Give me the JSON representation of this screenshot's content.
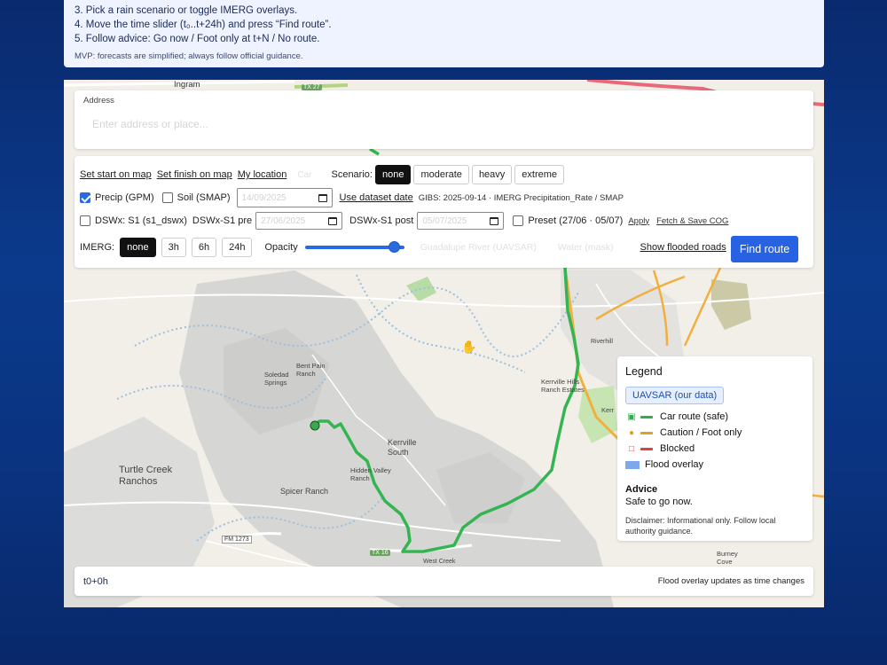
{
  "instructions": {
    "steps": [
      "3. Pick a rain scenario or toggle IMERG overlays.",
      "4. Move the time slider (t₀..t+24h) and press “Find route”.",
      "5. Follow advice: Go now / Foot only at t+N / No route."
    ],
    "disclaimer": "MVP: forecasts are simplified; always follow official guidance."
  },
  "map_labels": {
    "ingram": "Ingram",
    "tx27": "TX 27",
    "bent_pain": "Bent Pain Ranch",
    "soledad": "Soledad Springs",
    "kerrville_south": "Kerrville South",
    "hidden_valley": "Hidden Valley Ranch",
    "spicer": "Spicer Ranch",
    "turtle_creek": "Turtle Creek Ranchos",
    "fm1273": "FM 1273",
    "tx16": "TX 16",
    "west_creek": "West Creek",
    "kerrville_hills": "Kerrville Hills Ranch Estates",
    "riverhill": "Riverhill",
    "burney": "Burney Cove",
    "kerr": "Kerr"
  },
  "address": {
    "label": "Address",
    "placeholder": "Enter address or place..."
  },
  "controls": {
    "set_start": "Set start on map",
    "set_finish": "Set finish on map",
    "my_location": "My location",
    "car": "Car",
    "scenario_label": "Scenario:",
    "scenarios": [
      "none",
      "moderate",
      "heavy",
      "extreme"
    ],
    "scenario_active": "none",
    "precip_label": "Precip (GPM)",
    "soil_label": "Soil (SMAP)",
    "date_placeholder": "14/09/2025",
    "use_dataset_date": "Use dataset date",
    "gibs_info": "GIBS: 2025-09-14 · IMERG Precipitation_Rate / SMAP",
    "dswx_label": "DSWx: S1 (s1_dswx)",
    "dswx_pre_label": "DSWx-S1 pre",
    "dswx_pre_placeholder": "27/06/2025",
    "dswx_post_label": "DSWx-S1 post",
    "dswx_post_placeholder": "05/07/2025",
    "preset_label": "Preset (27/06 · 05/07)",
    "apply": "Apply",
    "fetch_save": "Fetch & Save COG",
    "imerg_label": "IMERG:",
    "imerg_options": [
      "none",
      "3h",
      "6h",
      "24h"
    ],
    "imerg_active": "none",
    "opacity_label": "Opacity",
    "opacity_value": 0.9,
    "guadalupe": "Guadalupe River (UAVSAR)",
    "water_mask": "Water (mask)",
    "show_flooded": "Show flooded roads",
    "find_route": "Find route"
  },
  "legend": {
    "title": "Legend",
    "badge": "UAVSAR (our data)",
    "items": [
      {
        "icon": "car-icon",
        "label": "Car route (safe)",
        "color": "#2fae4f"
      },
      {
        "icon": "walk-icon",
        "label": "Caution / Foot only",
        "color": "#e0a020"
      },
      {
        "icon": "lock-icon",
        "label": "Blocked",
        "color": "#e04040"
      }
    ],
    "flood_overlay": "Flood overlay",
    "advice_title": "Advice",
    "advice_value": "Safe to go now.",
    "disclaimer": "Disclaimer: Informational only. Follow local authority guidance."
  },
  "timebar": {
    "time": "t0+0h",
    "note": "Flood overlay updates as time changes"
  },
  "colors": {
    "route": "#35b552",
    "accent": "#2762e3",
    "road_orange": "#f0b040",
    "road_red": "#e8697a"
  }
}
